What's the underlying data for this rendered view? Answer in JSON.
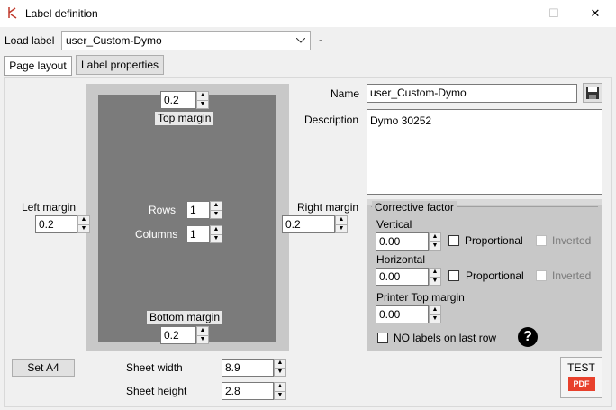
{
  "window": {
    "title": "Label definition",
    "minimize_glyph": "—",
    "maximize_glyph": "☐",
    "close_glyph": "✕"
  },
  "load_label": {
    "label": "Load label",
    "selected": "user_Custom-Dymo",
    "dash": "-"
  },
  "tabs": [
    "Page layout",
    "Label properties"
  ],
  "page_layout": {
    "top_margin_label": "Top margin",
    "top_margin_value": "0.2",
    "bottom_margin_label": "Bottom margin",
    "bottom_margin_value": "0.2",
    "left_margin_label": "Left margin",
    "left_margin_value": "0.2",
    "right_margin_label": "Right margin",
    "right_margin_value": "0.2",
    "rows_label": "Rows",
    "rows_value": "1",
    "columns_label": "Columns",
    "columns_value": "1"
  },
  "properties": {
    "name_label": "Name",
    "name_value": "user_Custom-Dymo",
    "description_label": "Description",
    "description_value": "Dymo 30252"
  },
  "corrective": {
    "title": "Corrective factor",
    "vertical_label": "Vertical",
    "vertical_value": "0.00",
    "horizontal_label": "Horizontal",
    "horizontal_value": "0.00",
    "proportional_label": "Proportional",
    "inverted_label": "Inverted",
    "printer_top_margin_label": "Printer Top margin",
    "printer_top_margin_value": "0.00",
    "no_labels_last_row": "NO labels on last row",
    "help_glyph": "?"
  },
  "sheet": {
    "set_a4": "Set A4",
    "width_label": "Sheet width",
    "width_value": "8.9",
    "height_label": "Sheet height",
    "height_value": "2.8"
  },
  "test_button": {
    "label": "TEST",
    "badge": "PDF"
  },
  "icons": [
    "app-icon",
    "chevron-down-icon",
    "save-icon",
    "help-icon",
    "pdf-icon"
  ]
}
